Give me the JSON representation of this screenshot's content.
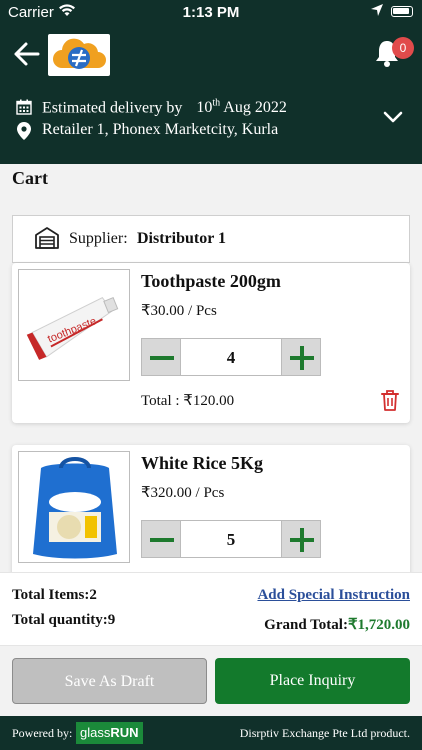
{
  "status_bar": {
    "carrier": "Carrier",
    "time": "1:13 PM"
  },
  "header": {
    "notification_count": "0"
  },
  "delivery": {
    "label": "Estimated delivery by",
    "date_day": "10",
    "date_suffix": "th",
    "date_rest": " Aug 2022",
    "address": "Retailer 1, Phonex Marketcity, Kurla"
  },
  "cart": {
    "title": "Cart",
    "supplier_label": "Supplier:",
    "supplier_name": "Distributor 1",
    "items": [
      {
        "name": "Toothpaste 200gm",
        "price": "₹30.00 / Pcs",
        "qty": "4",
        "total": "Total : ₹120.00",
        "image_text": "toothpaste"
      },
      {
        "name": "White Rice 5Kg",
        "price": "₹320.00 / Pcs",
        "qty": "5"
      }
    ]
  },
  "summary": {
    "total_items": "Total Items:2",
    "total_quantity": "Total quantity:9",
    "special_instruction": "Add Special Instruction",
    "grand_total_label": "Grand Total:",
    "grand_total_value": "₹1,720.00"
  },
  "buttons": {
    "draft": "Save As Draft",
    "place": "Place Inquiry"
  },
  "footer": {
    "powered_by": "Powered by:",
    "brand_a": "glass",
    "brand_b": "RUN",
    "company": "Disrptiv Exchange Pte Ltd product."
  },
  "colors": {
    "header_bg": "#10302a",
    "accent_green": "#137a2c",
    "badge_red": "#e14b4b",
    "link_blue": "#2b4f9a",
    "delete_red": "#d32f2f"
  }
}
